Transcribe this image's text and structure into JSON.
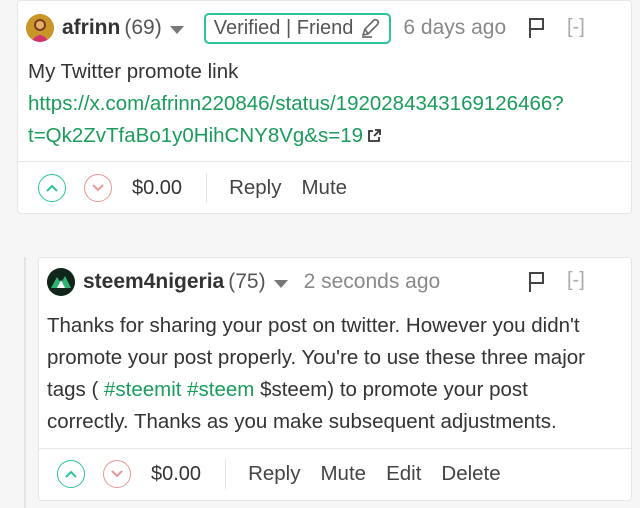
{
  "comment1": {
    "author": "afrinn",
    "reputation": "(69)",
    "badge": "Verified | Friend",
    "time": "6 days ago",
    "collapse": "[-]",
    "body_line": "My Twitter promote link",
    "link_line1": "https://x.com/afrinn220846/status/1920284343169126466?",
    "link_line2": "t=Qk2ZvTfaBo1y0HihCNY8Vg&s=19",
    "payout": "$0.00",
    "actions": {
      "reply": "Reply",
      "mute": "Mute"
    }
  },
  "comment2": {
    "author": "steem4nigeria",
    "reputation": "(75)",
    "time": "2 seconds ago",
    "collapse": "[-]",
    "text_line1": "Thanks for sharing your post on twitter. However you didn't",
    "text_line2": "promote your post properly. You're to use these three major",
    "text_line3_pre": "tags ( ",
    "tag1": "#steemit",
    "tag2": "#steem",
    "text_line3_post": " $steem) to promote your post",
    "text_line4": "correctly. Thanks as you make subsequent adjustments.",
    "payout": "$0.00",
    "actions": {
      "reply": "Reply",
      "mute": "Mute",
      "edit": "Edit",
      "delete": "Delete"
    }
  },
  "colors": {
    "accent_green": "#2cc49c",
    "link_green": "#1a9c5a",
    "downvote_red": "#e79898"
  }
}
